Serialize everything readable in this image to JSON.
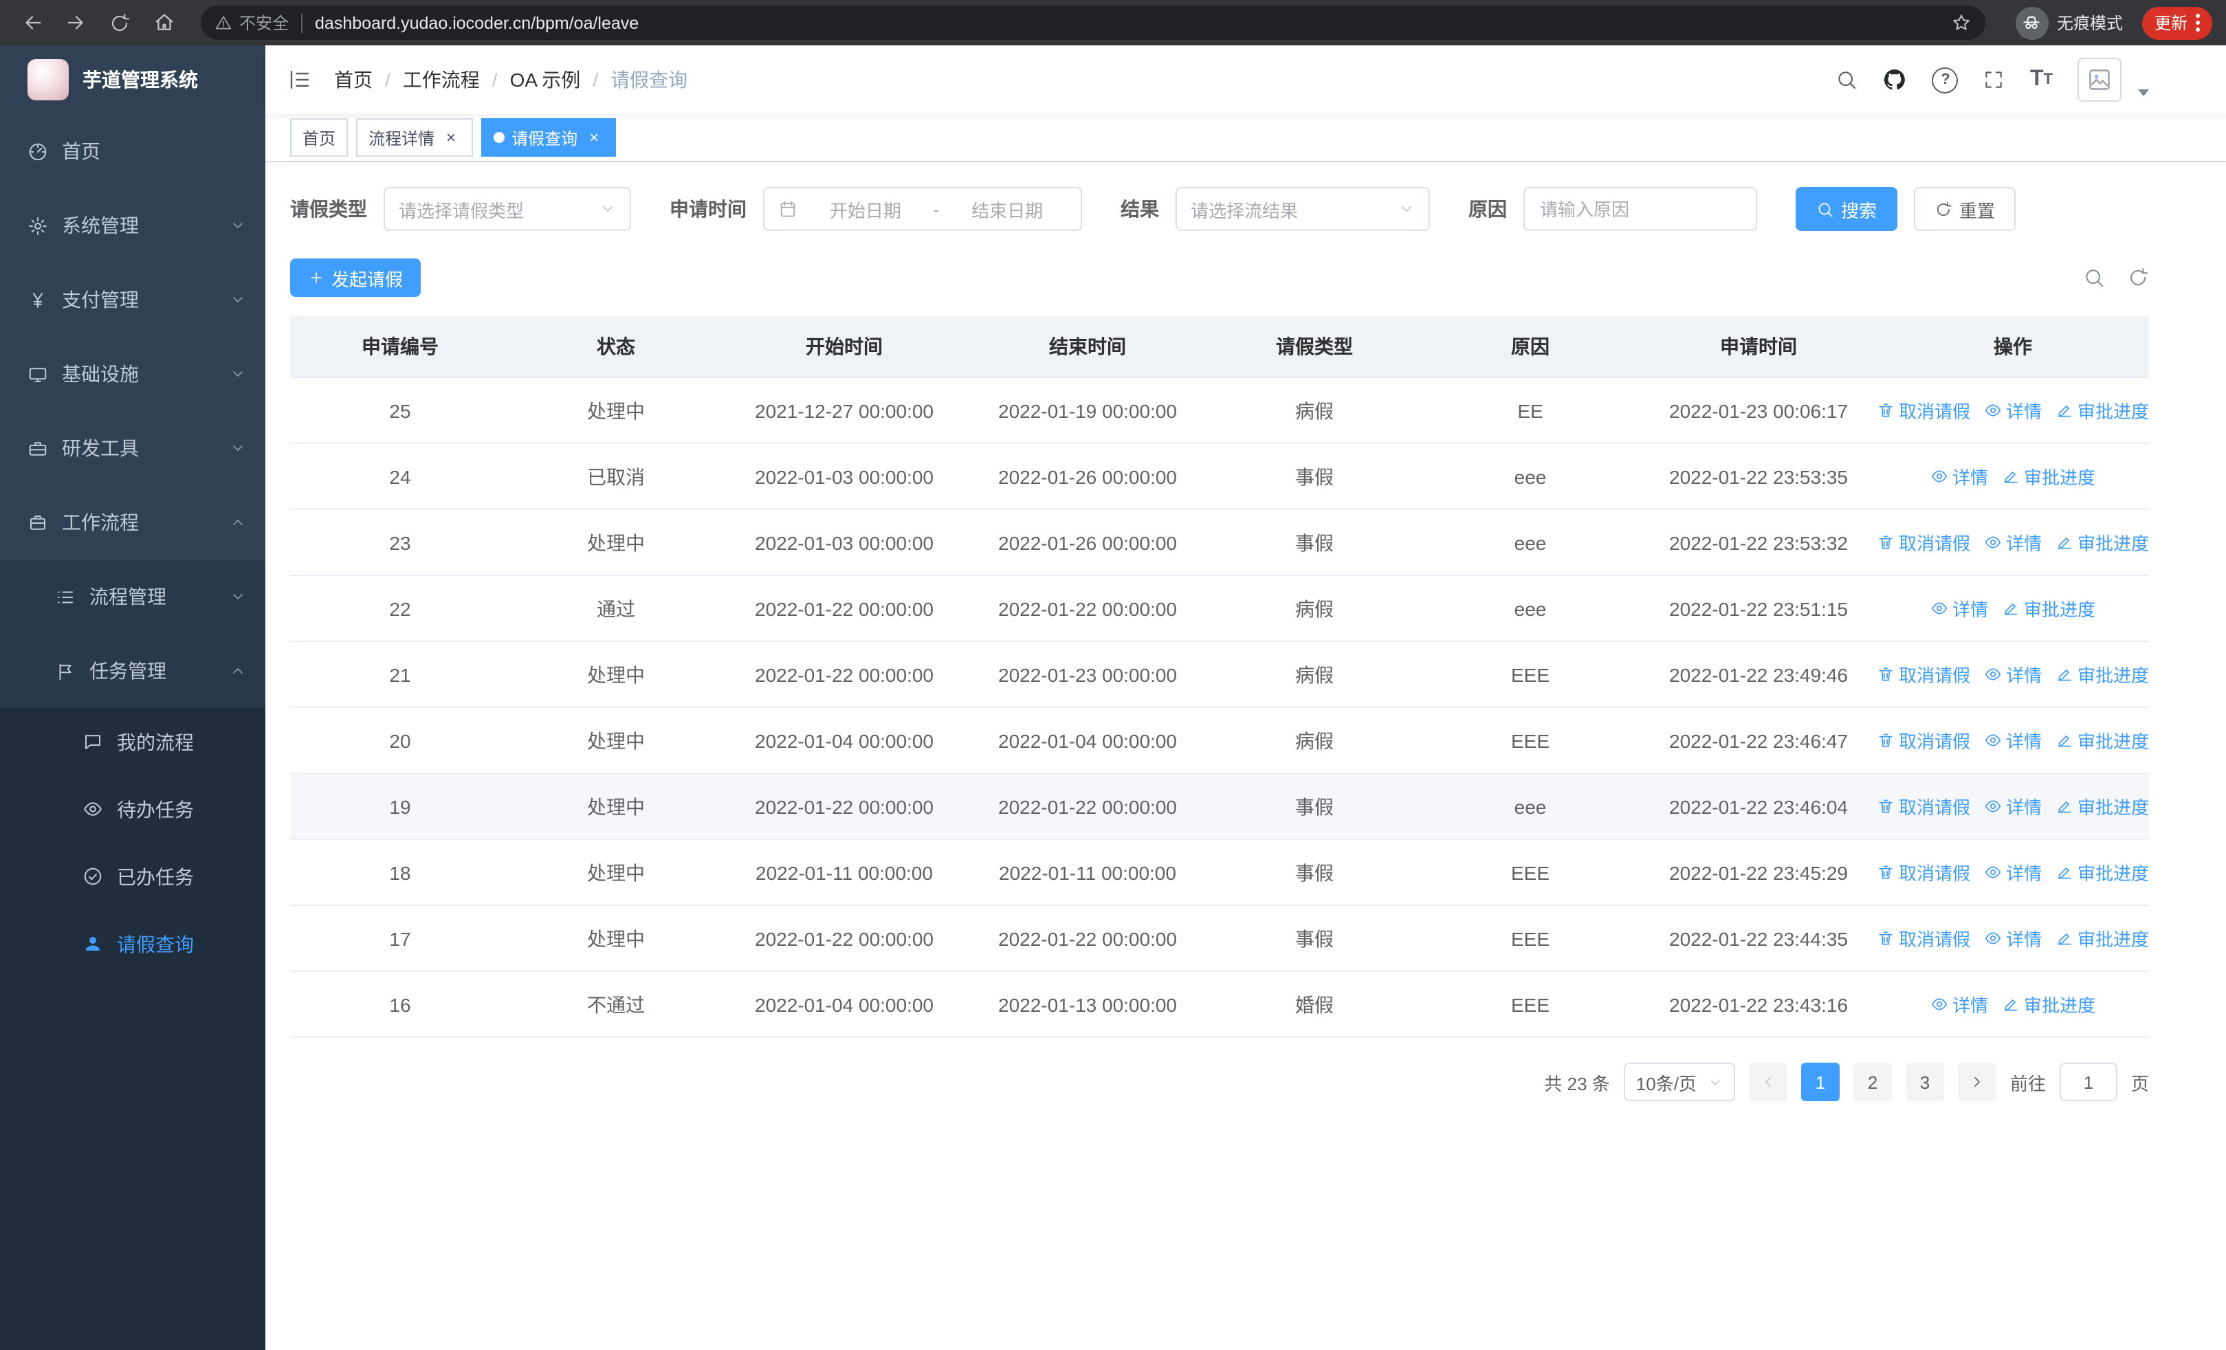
{
  "colors": {
    "primary": "#409eff",
    "sidebar-bg": "#304156",
    "sidebar-sub-bg": "#28394b",
    "sidebar-subsub-bg": "#1f2d3d",
    "update-btn": "#d93025"
  },
  "browser": {
    "security_label": "不安全",
    "url": "dashboard.yudao.iocoder.cn/bpm/oa/leave",
    "incognito_label": "无痕模式",
    "update_label": "更新"
  },
  "sidebar": {
    "logo_title": "芋道管理系统",
    "items": [
      {
        "label": "首页",
        "icon": "dashboard-icon"
      },
      {
        "label": "系统管理",
        "icon": "gear-icon",
        "chevron": "down"
      },
      {
        "label": "支付管理",
        "icon": "yen-icon",
        "chevron": "down"
      },
      {
        "label": "基础设施",
        "icon": "monitor-icon",
        "chevron": "down"
      },
      {
        "label": "研发工具",
        "icon": "toolbox-icon",
        "chevron": "down"
      },
      {
        "label": "工作流程",
        "icon": "briefcase-icon",
        "chevron": "up",
        "expanded": true
      }
    ],
    "submenu": [
      {
        "label": "流程管理",
        "icon": "list-icon",
        "chevron": "down"
      },
      {
        "label": "任务管理",
        "icon": "flag-icon",
        "chevron": "up",
        "expanded": true
      }
    ],
    "task_children": [
      {
        "label": "我的流程",
        "icon": "chat-icon"
      },
      {
        "label": "待办任务",
        "icon": "eye-icon"
      },
      {
        "label": "已办任务",
        "icon": "check-circle-icon"
      },
      {
        "label": "请假查询",
        "icon": "user-icon",
        "active": true
      }
    ]
  },
  "header": {
    "breadcrumb": [
      "首页",
      "工作流程",
      "OA 示例",
      "请假查询"
    ],
    "separator": "/"
  },
  "tabs": [
    {
      "label": "首页",
      "closable": false,
      "active": false
    },
    {
      "label": "流程详情",
      "closable": true,
      "active": false
    },
    {
      "label": "请假查询",
      "closable": true,
      "active": true
    }
  ],
  "filters": {
    "leave_type_label": "请假类型",
    "leave_type_placeholder": "请选择请假类型",
    "apply_time_label": "申请时间",
    "start_date_placeholder": "开始日期",
    "range_separator": "-",
    "end_date_placeholder": "结束日期",
    "result_label": "结果",
    "result_placeholder": "请选择流结果",
    "reason_label": "原因",
    "reason_placeholder": "请输入原因",
    "search_label": "搜索",
    "reset_label": "重置"
  },
  "toolbar": {
    "create_label": "发起请假"
  },
  "table": {
    "columns": [
      "申请编号",
      "状态",
      "开始时间",
      "结束时间",
      "请假类型",
      "原因",
      "申请时间",
      "操作"
    ],
    "action_labels": {
      "cancel": "取消请假",
      "detail": "详情",
      "progress": "审批进度"
    },
    "rows": [
      {
        "id": "25",
        "status": "处理中",
        "start": "2021-12-27 00:00:00",
        "end": "2022-01-19 00:00:00",
        "type": "病假",
        "reason": "EE",
        "applied": "2022-01-23 00:06:17",
        "actions": [
          "cancel",
          "detail",
          "progress"
        ],
        "highlighted": false
      },
      {
        "id": "24",
        "status": "已取消",
        "start": "2022-01-03 00:00:00",
        "end": "2022-01-26 00:00:00",
        "type": "事假",
        "reason": "eee",
        "applied": "2022-01-22 23:53:35",
        "actions": [
          "detail",
          "progress"
        ],
        "highlighted": false
      },
      {
        "id": "23",
        "status": "处理中",
        "start": "2022-01-03 00:00:00",
        "end": "2022-01-26 00:00:00",
        "type": "事假",
        "reason": "eee",
        "applied": "2022-01-22 23:53:32",
        "actions": [
          "cancel",
          "detail",
          "progress"
        ],
        "highlighted": false
      },
      {
        "id": "22",
        "status": "通过",
        "start": "2022-01-22 00:00:00",
        "end": "2022-01-22 00:00:00",
        "type": "病假",
        "reason": "eee",
        "applied": "2022-01-22 23:51:15",
        "actions": [
          "detail",
          "progress"
        ],
        "highlighted": false
      },
      {
        "id": "21",
        "status": "处理中",
        "start": "2022-01-22 00:00:00",
        "end": "2022-01-23 00:00:00",
        "type": "病假",
        "reason": "EEE",
        "applied": "2022-01-22 23:49:46",
        "actions": [
          "cancel",
          "detail",
          "progress"
        ],
        "highlighted": false
      },
      {
        "id": "20",
        "status": "处理中",
        "start": "2022-01-04 00:00:00",
        "end": "2022-01-04 00:00:00",
        "type": "病假",
        "reason": "EEE",
        "applied": "2022-01-22 23:46:47",
        "actions": [
          "cancel",
          "detail",
          "progress"
        ],
        "highlighted": false
      },
      {
        "id": "19",
        "status": "处理中",
        "start": "2022-01-22 00:00:00",
        "end": "2022-01-22 00:00:00",
        "type": "事假",
        "reason": "eee",
        "applied": "2022-01-22 23:46:04",
        "actions": [
          "cancel",
          "detail",
          "progress"
        ],
        "highlighted": true
      },
      {
        "id": "18",
        "status": "处理中",
        "start": "2022-01-11 00:00:00",
        "end": "2022-01-11 00:00:00",
        "type": "事假",
        "reason": "EEE",
        "applied": "2022-01-22 23:45:29",
        "actions": [
          "cancel",
          "detail",
          "progress"
        ],
        "highlighted": false
      },
      {
        "id": "17",
        "status": "处理中",
        "start": "2022-01-22 00:00:00",
        "end": "2022-01-22 00:00:00",
        "type": "事假",
        "reason": "EEE",
        "applied": "2022-01-22 23:44:35",
        "actions": [
          "cancel",
          "detail",
          "progress"
        ],
        "highlighted": false
      },
      {
        "id": "16",
        "status": "不通过",
        "start": "2022-01-04 00:00:00",
        "end": "2022-01-13 00:00:00",
        "type": "婚假",
        "reason": "EEE",
        "applied": "2022-01-22 23:43:16",
        "actions": [
          "detail",
          "progress"
        ],
        "highlighted": false
      }
    ]
  },
  "pagination": {
    "total_text": "共 23 条",
    "page_size_text": "10条/页",
    "pages": [
      "1",
      "2",
      "3"
    ],
    "active_page": "1",
    "goto_prefix": "前往",
    "goto_value": "1",
    "goto_suffix": "页"
  }
}
